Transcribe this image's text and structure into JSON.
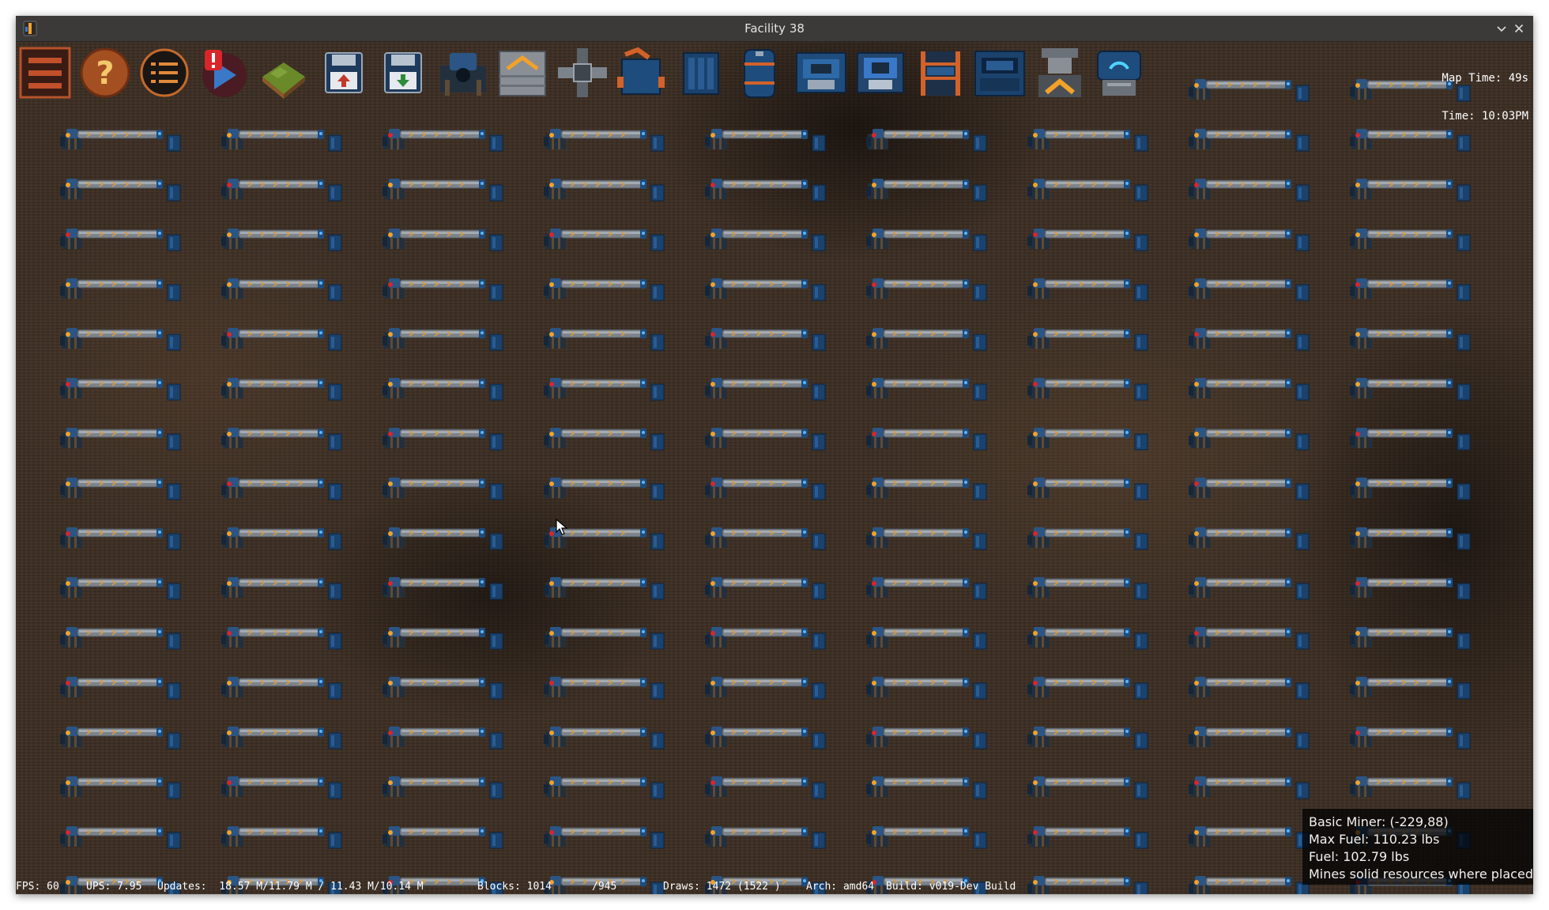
{
  "window": {
    "title": "Facility 38",
    "app_icon": "facility-app-icon",
    "minimize_icon": "chevron-down-icon",
    "close_icon": "close-icon"
  },
  "toolbar": {
    "items": [
      {
        "name": "main-menu-button",
        "icon": "menu-bars-icon"
      },
      {
        "name": "help-button",
        "icon": "question-mark-icon"
      },
      {
        "name": "task-list-button",
        "icon": "list-icon"
      },
      {
        "name": "alerts-button",
        "icon": "alert-icon"
      },
      {
        "name": "terrain-button",
        "icon": "terrain-block-icon"
      },
      {
        "name": "save-button",
        "icon": "save-upload-icon"
      },
      {
        "name": "load-button",
        "icon": "save-download-icon"
      },
      {
        "name": "basic-miner-tool",
        "icon": "miner-icon"
      },
      {
        "name": "conveyor-tool",
        "icon": "conveyor-icon"
      },
      {
        "name": "splitter-tool",
        "icon": "splitter-icon"
      },
      {
        "name": "inserter-tool",
        "icon": "inserter-icon"
      },
      {
        "name": "box-tool",
        "icon": "storage-box-icon"
      },
      {
        "name": "fuel-tank-tool",
        "icon": "fuel-tank-icon"
      },
      {
        "name": "smelter-tool",
        "icon": "smelter-icon"
      },
      {
        "name": "assembler-tool",
        "icon": "assembler-icon"
      },
      {
        "name": "shelf-tool",
        "icon": "shelf-icon"
      },
      {
        "name": "generator-tool",
        "icon": "generator-icon"
      },
      {
        "name": "lift-tool",
        "icon": "lift-icon"
      },
      {
        "name": "research-tool",
        "icon": "research-icon"
      }
    ]
  },
  "hud": {
    "map_time": "Map Time: 49s",
    "time": "Time: 10:03PM"
  },
  "tooltip": {
    "line1": "Basic Miner: (-229,88)",
    "line2": "Max Fuel: 110.23 lbs",
    "line3": "Fuel: 102.79 lbs",
    "line4": "Mines solid resources where placed"
  },
  "status": {
    "fps": "FPS: 60",
    "ups": "UPS: 7.95",
    "updates": "Updates:  18.57 M/11.79 M / 11.43 M/10.14 M",
    "blocks": "Blocks: 1014",
    "blocks_total": "/945",
    "draws": "Draws: 1472 (1522 )",
    "arch": "Arch: amd64",
    "build": "Build: v019-Dev Build"
  },
  "colors": {
    "ground": "#3c2e23",
    "machine_blue": "#1e4c7c",
    "belt_grey": "#8a8f96",
    "accent_orange": "#f2a228",
    "status_red": "#d8262a",
    "titlebar": "#3b3a39"
  }
}
